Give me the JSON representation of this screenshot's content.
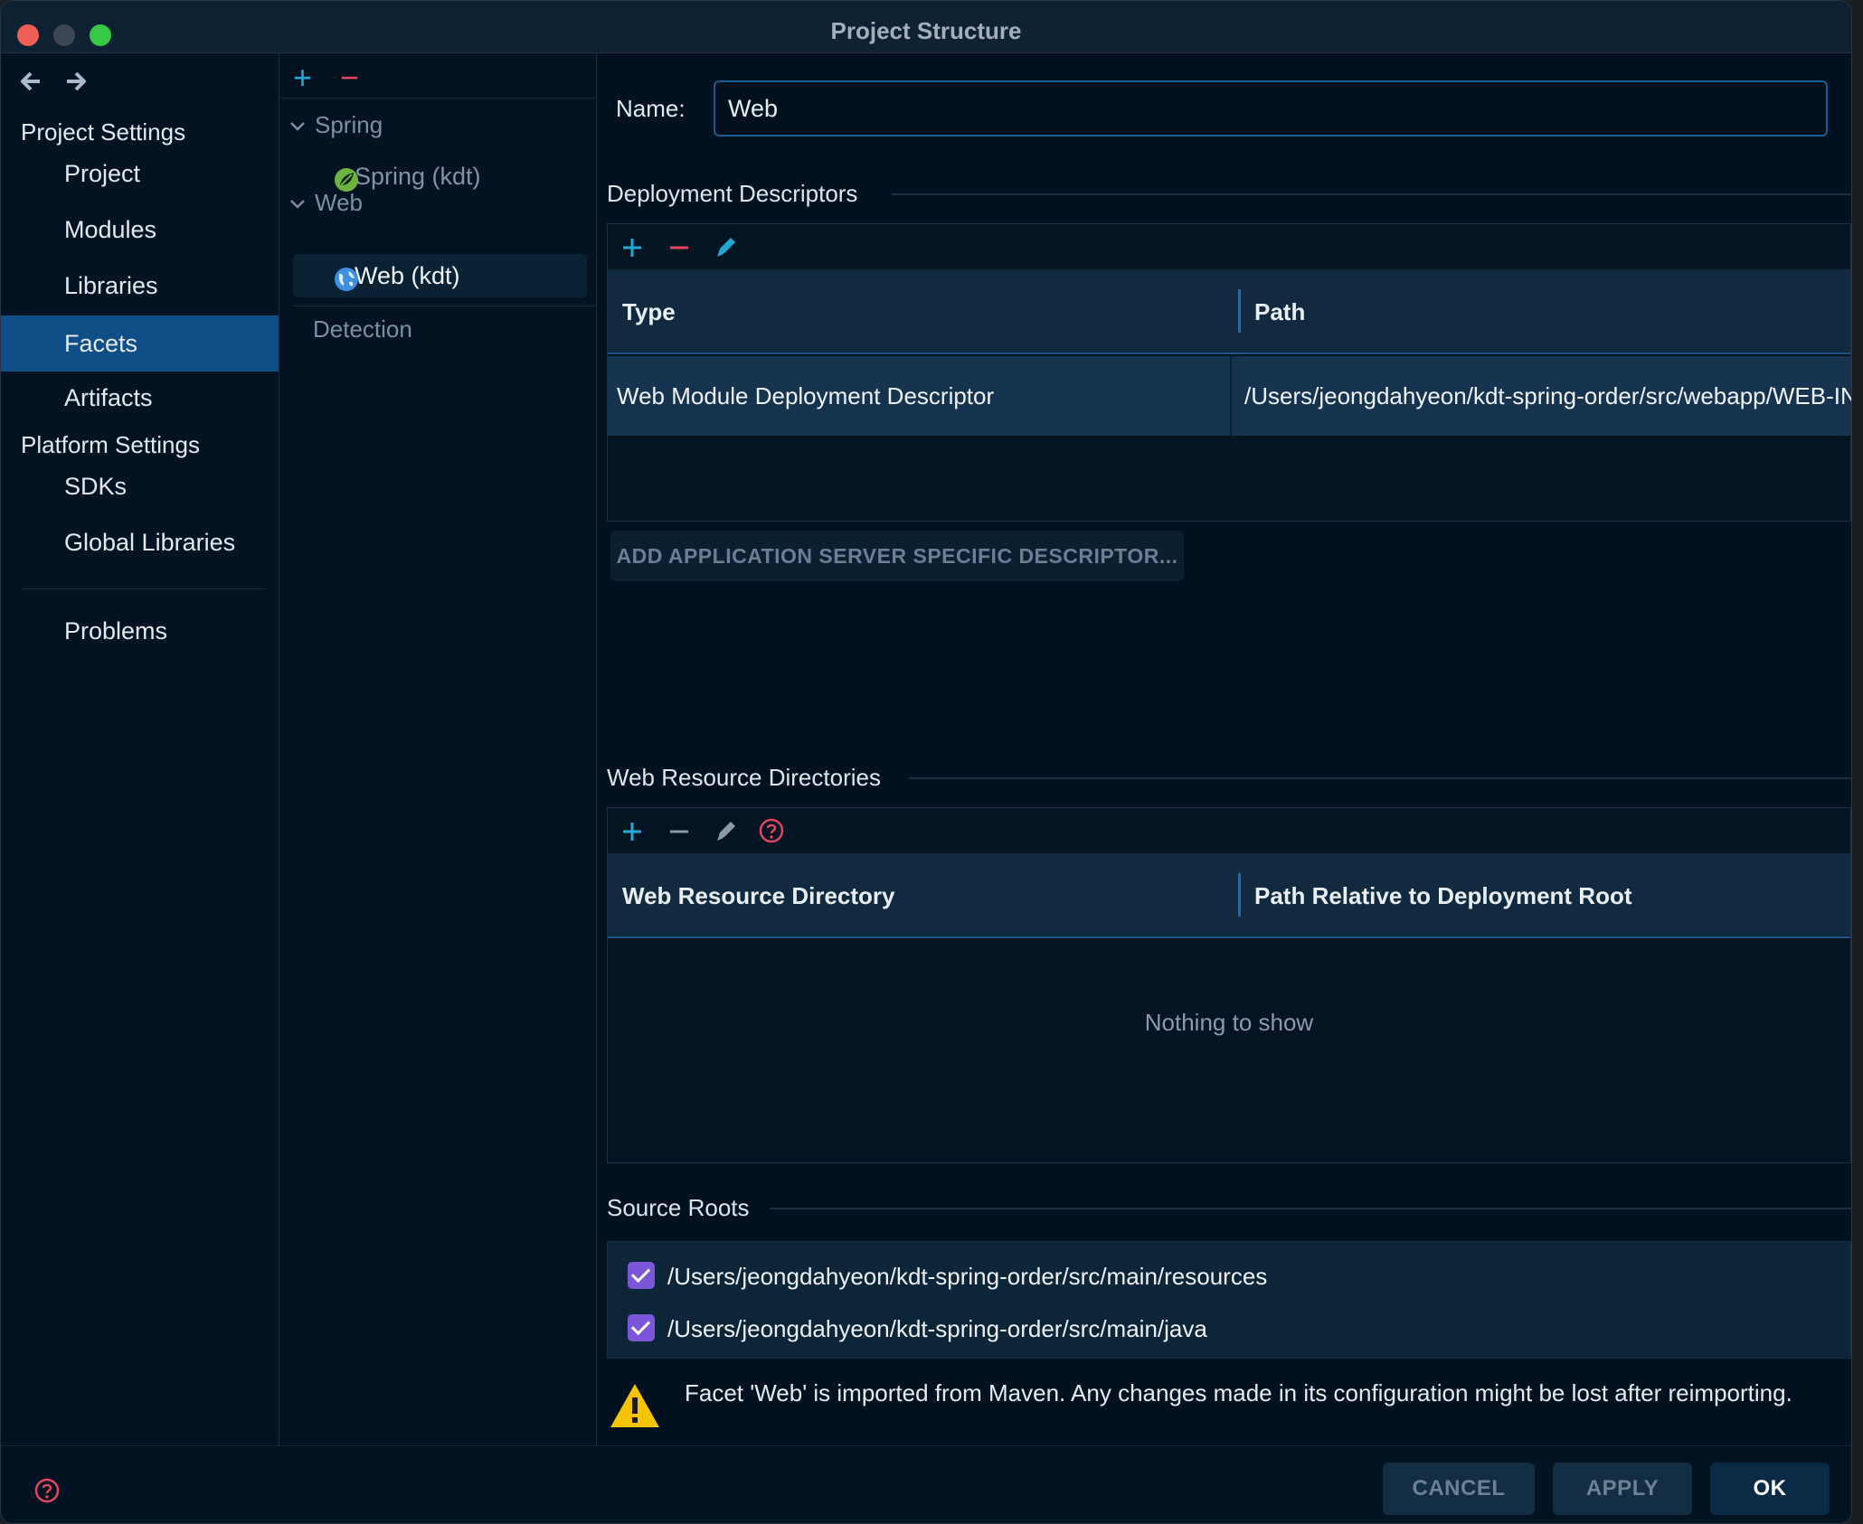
{
  "window": {
    "title": "Project Structure"
  },
  "nav": {
    "back_icon": "arrow-left-icon",
    "forward_icon": "arrow-right-icon",
    "project_settings_header": "Project Settings",
    "project_items": [
      "Project",
      "Modules",
      "Libraries",
      "Facets",
      "Artifacts"
    ],
    "selected_item": "Facets",
    "platform_settings_header": "Platform Settings",
    "platform_items": [
      "SDKs",
      "Global Libraries"
    ],
    "problems_label": "Problems"
  },
  "tree": {
    "add_symbol": "+",
    "remove_symbol": "−",
    "groups": [
      {
        "label": "Spring",
        "children": [
          {
            "label": "Spring (kdt)",
            "icon": "spring-leaf-icon"
          }
        ]
      },
      {
        "label": "Web",
        "children": [
          {
            "label": "Web (kdt)",
            "icon": "globe-icon",
            "selected": true
          }
        ]
      }
    ],
    "detection_label": "Detection"
  },
  "content": {
    "name_label": "Name:",
    "name_value": "Web",
    "deployment": {
      "title": "Deployment Descriptors",
      "columns": [
        "Type",
        "Path"
      ],
      "rows": [
        {
          "type": "Web Module Deployment Descriptor",
          "path": "/Users/jeongdahyeon/kdt-spring-order/src/webapp/WEB-INF/web.xml"
        }
      ],
      "add_server_button": "ADD APPLICATION SERVER SPECIFIC DESCRIPTOR..."
    },
    "web_resources": {
      "title": "Web Resource Directories",
      "columns": [
        "Web Resource Directory",
        "Path Relative to Deployment Root"
      ],
      "empty_text": "Nothing to show"
    },
    "source_roots": {
      "title": "Source Roots",
      "items": [
        {
          "path": "/Users/jeongdahyeon/kdt-spring-order/src/main/resources",
          "checked": true
        },
        {
          "path": "/Users/jeongdahyeon/kdt-spring-order/src/main/java",
          "checked": true
        }
      ]
    },
    "warning_text": "Facet 'Web' is imported from Maven. Any changes made in its configuration might be lost after reimporting."
  },
  "footer": {
    "cancel_label": "CANCEL",
    "apply_label": "APPLY",
    "ok_label": "OK"
  },
  "colors": {
    "accent_blue": "#23a8d6",
    "danger_red": "#e0465f",
    "selection": "#0f4e86",
    "checkbox": "#7b56d8",
    "warning_yellow": "#f5c400"
  }
}
